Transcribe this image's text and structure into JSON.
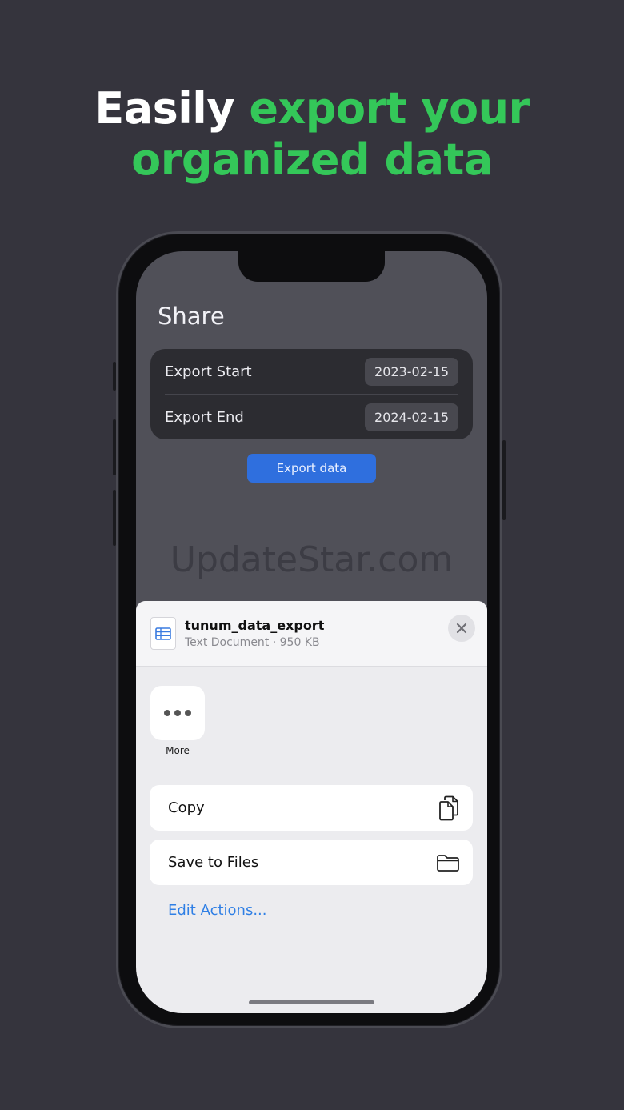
{
  "headline": {
    "part1": "Easily ",
    "part2": "export your",
    "part3": "organized data"
  },
  "screen": {
    "title": "Share",
    "export_start": {
      "label": "Export Start",
      "value": "2023-02-15"
    },
    "export_end": {
      "label": "Export End",
      "value": "2024-02-15"
    },
    "export_button": "Export data",
    "watermark": "UpdateStar.com"
  },
  "sheet": {
    "file_name": "tunum_data_export",
    "file_meta": "Text Document · 950 KB",
    "more_label": "More",
    "actions": [
      {
        "label": "Copy",
        "icon": "copy-icon"
      },
      {
        "label": "Save to Files",
        "icon": "folder-icon"
      }
    ],
    "edit_actions": "Edit Actions..."
  },
  "colors": {
    "background": "#35343d",
    "accent_green": "#34c759",
    "button_blue": "#2f6fde",
    "link_blue": "#2f7fe5"
  }
}
